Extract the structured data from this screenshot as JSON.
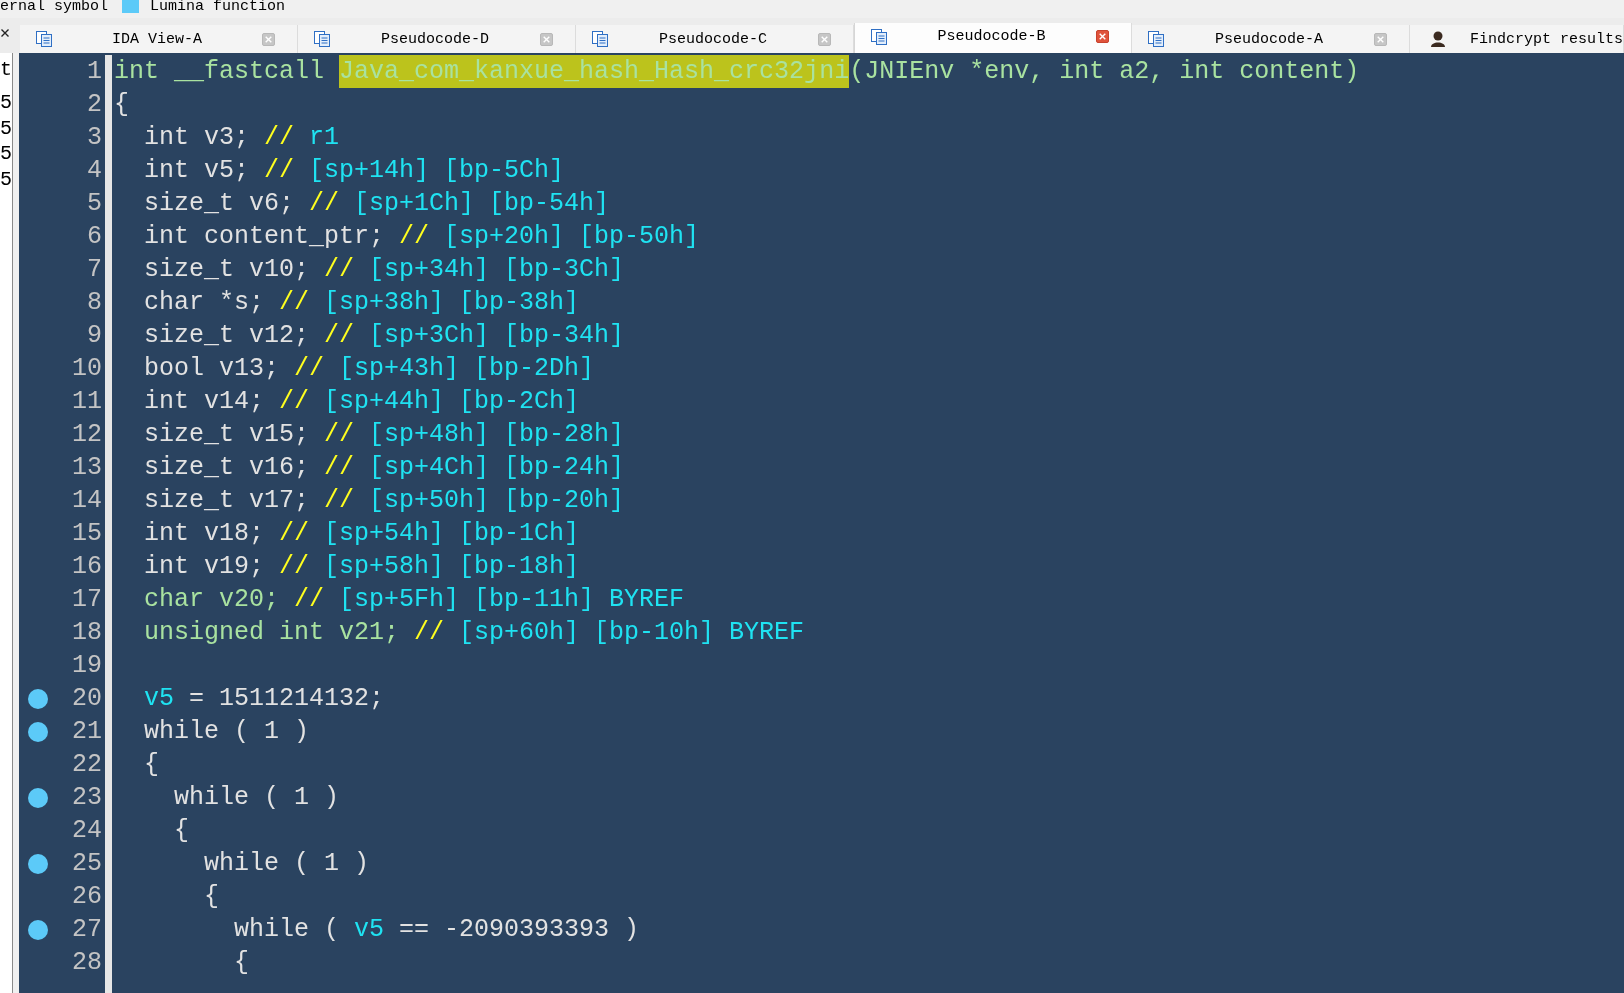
{
  "legend": [
    {
      "label": "ernal symbol"
    },
    {
      "label": "Lumina function",
      "color": "#5ccaf8"
    }
  ],
  "tabs": [
    {
      "label": "IDA View-A",
      "kind": "disassembly",
      "selected": false,
      "closable": true
    },
    {
      "label": "Pseudocode-D",
      "kind": "pseudocode",
      "selected": false,
      "closable": true
    },
    {
      "label": "Pseudocode-C",
      "kind": "pseudocode",
      "selected": false,
      "closable": true
    },
    {
      "label": "Pseudocode-B",
      "kind": "pseudocode",
      "selected": true,
      "closable": true
    },
    {
      "label": "Pseudocode-A",
      "kind": "pseudocode",
      "selected": false,
      "closable": true
    },
    {
      "label": "Findcrypt results",
      "kind": "plugin",
      "selected": false,
      "closable": false
    }
  ],
  "side_panel": {
    "items": [
      "t",
      "5",
      "5",
      "5",
      "5"
    ]
  },
  "editor": {
    "lines": [
      {
        "number": "1",
        "breakpoint": false,
        "code": [
          {
            "text": "int __fastcall ",
            "kind": "keyword"
          },
          {
            "text": "Java_com_kanxue_hash_Hash_crc32jni",
            "kind": "selected"
          },
          {
            "text": "(JNIEnv *env, int a2, int content)",
            "kind": "keyword"
          }
        ]
      },
      {
        "number": "2",
        "breakpoint": false,
        "code": [
          {
            "text": "{",
            "kind": "plain"
          }
        ]
      },
      {
        "number": "3",
        "breakpoint": false,
        "code": [
          {
            "text": "  int v3; ",
            "kind": "plain"
          },
          {
            "text": "// ",
            "kind": "comment"
          },
          {
            "text": "r1",
            "kind": "annotation"
          }
        ]
      },
      {
        "number": "4",
        "breakpoint": false,
        "code": [
          {
            "text": "  int v5; ",
            "kind": "plain"
          },
          {
            "text": "// ",
            "kind": "comment"
          },
          {
            "text": "[sp+14h] [bp-5Ch]",
            "kind": "annotation"
          }
        ]
      },
      {
        "number": "5",
        "breakpoint": false,
        "code": [
          {
            "text": "  size_t v6; ",
            "kind": "plain"
          },
          {
            "text": "// ",
            "kind": "comment"
          },
          {
            "text": "[sp+1Ch] [bp-54h]",
            "kind": "annotation"
          }
        ]
      },
      {
        "number": "6",
        "breakpoint": false,
        "code": [
          {
            "text": "  int content_ptr; ",
            "kind": "plain"
          },
          {
            "text": "// ",
            "kind": "comment"
          },
          {
            "text": "[sp+20h] [bp-50h]",
            "kind": "annotation"
          }
        ]
      },
      {
        "number": "7",
        "breakpoint": false,
        "code": [
          {
            "text": "  size_t v10; ",
            "kind": "plain"
          },
          {
            "text": "// ",
            "kind": "comment"
          },
          {
            "text": "[sp+34h] [bp-3Ch]",
            "kind": "annotation"
          }
        ]
      },
      {
        "number": "8",
        "breakpoint": false,
        "code": [
          {
            "text": "  char *s; ",
            "kind": "plain"
          },
          {
            "text": "// ",
            "kind": "comment"
          },
          {
            "text": "[sp+38h] [bp-38h]",
            "kind": "annotation"
          }
        ]
      },
      {
        "number": "9",
        "breakpoint": false,
        "code": [
          {
            "text": "  size_t v12; ",
            "kind": "plain"
          },
          {
            "text": "// ",
            "kind": "comment"
          },
          {
            "text": "[sp+3Ch] [bp-34h]",
            "kind": "annotation"
          }
        ]
      },
      {
        "number": "10",
        "breakpoint": false,
        "code": [
          {
            "text": "  bool v13; ",
            "kind": "plain"
          },
          {
            "text": "// ",
            "kind": "comment"
          },
          {
            "text": "[sp+43h] [bp-2Dh]",
            "kind": "annotation"
          }
        ]
      },
      {
        "number": "11",
        "breakpoint": false,
        "code": [
          {
            "text": "  int v14; ",
            "kind": "plain"
          },
          {
            "text": "// ",
            "kind": "comment"
          },
          {
            "text": "[sp+44h] [bp-2Ch]",
            "kind": "annotation"
          }
        ]
      },
      {
        "number": "12",
        "breakpoint": false,
        "code": [
          {
            "text": "  size_t v15; ",
            "kind": "plain"
          },
          {
            "text": "// ",
            "kind": "comment"
          },
          {
            "text": "[sp+48h] [bp-28h]",
            "kind": "annotation"
          }
        ]
      },
      {
        "number": "13",
        "breakpoint": false,
        "code": [
          {
            "text": "  size_t v16; ",
            "kind": "plain"
          },
          {
            "text": "// ",
            "kind": "comment"
          },
          {
            "text": "[sp+4Ch] [bp-24h]",
            "kind": "annotation"
          }
        ]
      },
      {
        "number": "14",
        "breakpoint": false,
        "code": [
          {
            "text": "  size_t v17; ",
            "kind": "plain"
          },
          {
            "text": "// ",
            "kind": "comment"
          },
          {
            "text": "[sp+50h] [bp-20h]",
            "kind": "annotation"
          }
        ]
      },
      {
        "number": "15",
        "breakpoint": false,
        "code": [
          {
            "text": "  int v18; ",
            "kind": "plain"
          },
          {
            "text": "// ",
            "kind": "comment"
          },
          {
            "text": "[sp+54h] [bp-1Ch]",
            "kind": "annotation"
          }
        ]
      },
      {
        "number": "16",
        "breakpoint": false,
        "code": [
          {
            "text": "  int v19; ",
            "kind": "plain"
          },
          {
            "text": "// ",
            "kind": "comment"
          },
          {
            "text": "[sp+58h] [bp-18h]",
            "kind": "annotation"
          }
        ]
      },
      {
        "number": "17",
        "breakpoint": false,
        "code": [
          {
            "text": "  char v20; ",
            "kind": "keyword"
          },
          {
            "text": "// ",
            "kind": "comment"
          },
          {
            "text": "[sp+5Fh] [bp-11h] BYREF",
            "kind": "annotation"
          }
        ]
      },
      {
        "number": "18",
        "breakpoint": false,
        "code": [
          {
            "text": "  unsigned int v21; ",
            "kind": "keyword"
          },
          {
            "text": "// ",
            "kind": "comment"
          },
          {
            "text": "[sp+60h] [bp-10h] BYREF",
            "kind": "annotation"
          }
        ]
      },
      {
        "number": "19",
        "breakpoint": false
      },
      {
        "number": "20",
        "breakpoint": true,
        "code": [
          {
            "text": "  v5",
            "kind": "variable"
          },
          {
            "text": " = 1511214132;",
            "kind": "plain"
          }
        ]
      },
      {
        "number": "21",
        "breakpoint": true,
        "code": [
          {
            "text": "  while ( 1 )",
            "kind": "plain"
          }
        ]
      },
      {
        "number": "22",
        "breakpoint": false,
        "code": [
          {
            "text": "  {",
            "kind": "plain"
          }
        ]
      },
      {
        "number": "23",
        "breakpoint": true,
        "code": [
          {
            "text": "    while ( 1 )",
            "kind": "plain"
          }
        ]
      },
      {
        "number": "24",
        "breakpoint": false,
        "code": [
          {
            "text": "    {",
            "kind": "plain"
          }
        ]
      },
      {
        "number": "25",
        "breakpoint": true,
        "code": [
          {
            "text": "      while ( 1 )",
            "kind": "plain"
          }
        ]
      },
      {
        "number": "26",
        "breakpoint": false,
        "code": [
          {
            "text": "      {",
            "kind": "plain"
          }
        ]
      },
      {
        "number": "27",
        "breakpoint": true,
        "code": [
          {
            "text": "        while ( ",
            "kind": "plain"
          },
          {
            "text": "v5",
            "kind": "variable"
          },
          {
            "text": " == -2090393393 )",
            "kind": "plain"
          }
        ]
      },
      {
        "number": "28",
        "breakpoint": false,
        "code": [
          {
            "text": "        {",
            "kind": "plain"
          }
        ]
      }
    ]
  }
}
